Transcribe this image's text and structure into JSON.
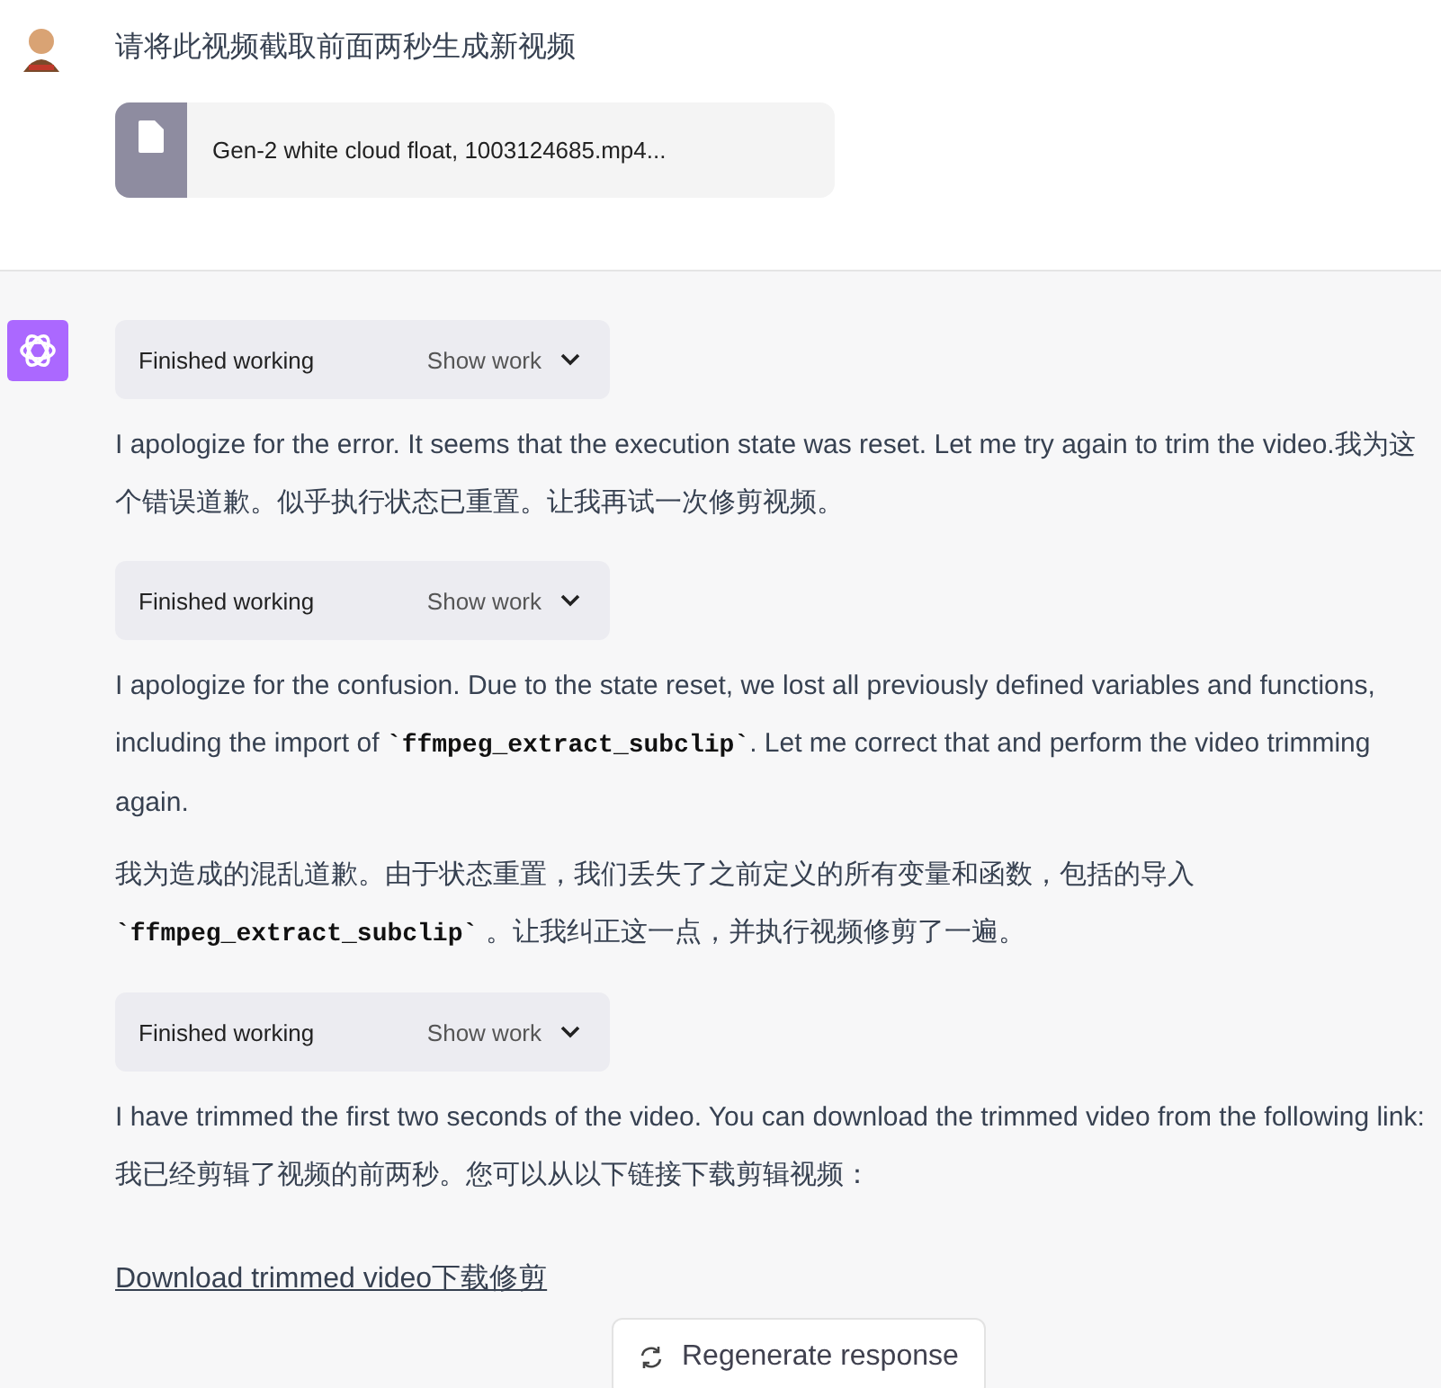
{
  "user": {
    "message": "请将此视频截取前面两秒生成新视频",
    "attachment": {
      "name": "Gen-2 white cloud float, 1003124685.mp4..."
    }
  },
  "assistant": {
    "blocks": [
      {
        "kind": "work",
        "status": "Finished working",
        "toggle": "Show work"
      },
      {
        "kind": "paragraph",
        "parts": [
          {
            "kind": "text",
            "text": "I apologize for the error. It seems that the execution state was reset. Let me try again to trim the video.我为这个错误道歉。似乎执行状态已重置。让我再试一次修剪视频。"
          }
        ]
      },
      {
        "kind": "work",
        "status": "Finished working",
        "toggle": "Show work"
      },
      {
        "kind": "paragraph",
        "parts": [
          {
            "kind": "text",
            "text": "I apologize for the confusion. Due to the state reset, we lost all previously defined variables and functions, including the import of "
          },
          {
            "kind": "code",
            "text": "`ffmpeg_extract_subclip`"
          },
          {
            "kind": "text",
            "text": ". Let me correct that and perform the video trimming again."
          }
        ]
      },
      {
        "kind": "paragraph",
        "parts": [
          {
            "kind": "text",
            "text": "我为造成的混乱道歉。由于状态重置，我们丢失了之前定义的所有变量和函数，包括的导入 "
          },
          {
            "kind": "code",
            "text": "`ffmpeg_extract_subclip`"
          },
          {
            "kind": "text",
            "text": " 。让我纠正这一点，并执行视频修剪了一遍。"
          }
        ]
      },
      {
        "kind": "work",
        "status": "Finished working",
        "toggle": "Show work"
      },
      {
        "kind": "paragraph",
        "parts": [
          {
            "kind": "text",
            "text": "I have trimmed the first two seconds of the video. You can download the trimmed video from the following link:我已经剪辑了视频的前两秒。您可以从以下链接下载剪辑视频："
          }
        ]
      },
      {
        "kind": "link",
        "text": "Download trimmed video下载修剪"
      }
    ]
  },
  "regenerate": {
    "label": "Regenerate response"
  }
}
